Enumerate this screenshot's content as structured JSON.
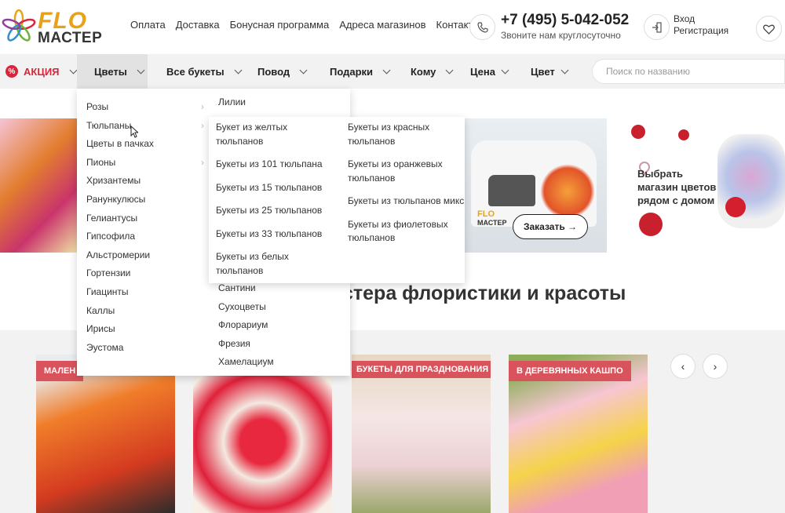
{
  "header": {
    "logo_top": "FLO",
    "logo_bottom": "МАСТЕР",
    "links": [
      "Оплата",
      "Доставка",
      "Бонусная программа",
      "Адреса магазинов",
      "Контакты"
    ],
    "phone": "+7 (495) 5-042-052",
    "phone_sub": "Звоните нам круглосуточно",
    "login": "Вход",
    "register": "Регистрация",
    "icons": [
      "phone-icon",
      "login-icon",
      "heart-icon"
    ]
  },
  "nav": {
    "sale": "АКЦИЯ",
    "items": [
      "Цветы",
      "Все букеты",
      "Повод",
      "Подарки",
      "Кому",
      "Цена",
      "Цвет"
    ],
    "search_placeholder": "Поиск по названию"
  },
  "menu": {
    "categories": [
      "Розы",
      "Тюльпаны",
      "Цветы в пачках",
      "Пионы",
      "Хризантемы",
      "Ранункулюсы",
      "Гелиантусы",
      "Гипсофила",
      "Альстромерии",
      "Гортензии",
      "Гиацинты",
      "Каллы",
      "Ирисы",
      "Эустома"
    ],
    "col2_first": "Лилии",
    "col2_rest": [
      "Сантини",
      "Сухоцветы",
      "Флорариум",
      "Фрезия",
      "Хамелациум"
    ],
    "tulip_sub_col1": [
      "Букет из желтых тюльпанов",
      "Букеты из 101 тюльпана",
      "Букеты из 15 тюльпанов",
      "Букеты из 25 тюльпанов",
      "Букеты из 33 тюльпанов",
      "Букеты из белых тюльпанов"
    ],
    "tulip_sub_col2": [
      "Букеты из красных тюльпанов",
      "Букеты из оранжевых тюльпанов",
      "Букеты из тюльпанов микс",
      "Букеты из фиолетовых тюльпанов"
    ]
  },
  "banners": {
    "van_logo_top": "FLO",
    "van_logo_bottom": "МАСТЕР",
    "order_button": "Заказать →",
    "store_text": "Выбрать магазин цветов рядом с домом"
  },
  "section_title": "стера флористики и красоты",
  "cards": [
    {
      "tag": "МАЛЕН"
    },
    {
      "tag": ""
    },
    {
      "tag": "БУКЕТЫ ДЛЯ ПРАЗДНОВАНИЯ ЛЮБОГО ПОВОДА"
    },
    {
      "tag": "В ДЕРЕВЯННЫХ КАШПО"
    }
  ],
  "carousel": {
    "prev": "‹",
    "next": "›"
  },
  "colors": {
    "accent": "#d9253a",
    "tag": "#d9535c",
    "logo_yellow": "#e8a21a"
  }
}
